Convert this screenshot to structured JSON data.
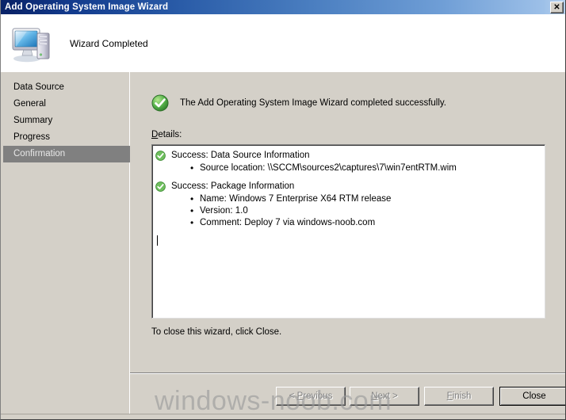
{
  "window": {
    "title": "Add Operating System Image Wizard",
    "close_button_glyph": "✕",
    "titlebar_color_start": "#0a246a",
    "titlebar_color_end": "#b9d3ef"
  },
  "header": {
    "title": "Wizard Completed",
    "icon": "computer-icon"
  },
  "sidebar": {
    "items": [
      {
        "label": "Data Source",
        "selected": false
      },
      {
        "label": "General",
        "selected": false
      },
      {
        "label": "Summary",
        "selected": false
      },
      {
        "label": "Progress",
        "selected": false
      },
      {
        "label": "Confirmation",
        "selected": true
      }
    ],
    "selected_color": "#808080"
  },
  "main": {
    "success_message": "The Add Operating System Image Wizard completed successfully.",
    "success_icon": "green-check-icon",
    "details_label_accel": "D",
    "details_label_rest": "etails:",
    "details": [
      {
        "icon": "green-check-icon",
        "heading": "Success: Data Source Information",
        "bullets": [
          "Source location: \\\\SCCM\\sources2\\captures\\7\\win7entRTM.wim"
        ]
      },
      {
        "icon": "green-check-icon",
        "heading": "Success: Package Information",
        "bullets": [
          "Name: Windows 7 Enterprise X64 RTM release",
          "Version: 1.0",
          "Comment: Deploy 7 via windows-noob.com"
        ]
      }
    ],
    "closing_text": "To close this wizard, click Close."
  },
  "footer": {
    "buttons": [
      {
        "name": "previous",
        "prefix": "< ",
        "accel": "P",
        "suffix": "revious",
        "disabled": true,
        "default": false
      },
      {
        "name": "next",
        "prefix": "",
        "accel": "N",
        "suffix": "ext >",
        "disabled": true,
        "default": false
      },
      {
        "name": "finish",
        "prefix": "",
        "accel": "F",
        "suffix": "inish",
        "disabled": true,
        "default": false
      },
      {
        "name": "close",
        "prefix": "",
        "accel": "",
        "suffix": "Close",
        "disabled": false,
        "default": true
      }
    ]
  },
  "watermark": {
    "text": "windows-noob.com",
    "color": "#9a9a9a"
  }
}
